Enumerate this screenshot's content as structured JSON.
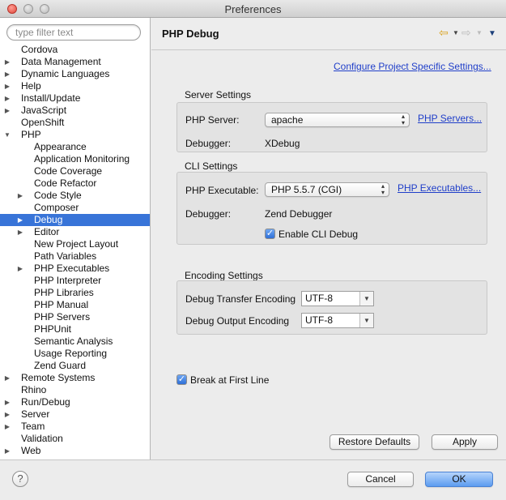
{
  "window": {
    "title": "Preferences"
  },
  "filter": {
    "placeholder": "type filter text"
  },
  "tree": [
    {
      "label": "Cordova",
      "level": 0,
      "arrow": ""
    },
    {
      "label": "Data Management",
      "level": 0,
      "arrow": "right"
    },
    {
      "label": "Dynamic Languages",
      "level": 0,
      "arrow": "right"
    },
    {
      "label": "Help",
      "level": 0,
      "arrow": "right"
    },
    {
      "label": "Install/Update",
      "level": 0,
      "arrow": "right"
    },
    {
      "label": "JavaScript",
      "level": 0,
      "arrow": "right"
    },
    {
      "label": "OpenShift",
      "level": 0,
      "arrow": ""
    },
    {
      "label": "PHP",
      "level": 0,
      "arrow": "down"
    },
    {
      "label": "Appearance",
      "level": 1,
      "arrow": ""
    },
    {
      "label": "Application Monitoring",
      "level": 1,
      "arrow": ""
    },
    {
      "label": "Code Coverage",
      "level": 1,
      "arrow": ""
    },
    {
      "label": "Code Refactor",
      "level": 1,
      "arrow": ""
    },
    {
      "label": "Code Style",
      "level": 1,
      "arrow": "right"
    },
    {
      "label": "Composer",
      "level": 1,
      "arrow": ""
    },
    {
      "label": "Debug",
      "level": 1,
      "arrow": "right",
      "selected": true
    },
    {
      "label": "Editor",
      "level": 1,
      "arrow": "right"
    },
    {
      "label": "New Project Layout",
      "level": 1,
      "arrow": ""
    },
    {
      "label": "Path Variables",
      "level": 1,
      "arrow": ""
    },
    {
      "label": "PHP Executables",
      "level": 1,
      "arrow": "right"
    },
    {
      "label": "PHP Interpreter",
      "level": 1,
      "arrow": ""
    },
    {
      "label": "PHP Libraries",
      "level": 1,
      "arrow": ""
    },
    {
      "label": "PHP Manual",
      "level": 1,
      "arrow": ""
    },
    {
      "label": "PHP Servers",
      "level": 1,
      "arrow": ""
    },
    {
      "label": "PHPUnit",
      "level": 1,
      "arrow": ""
    },
    {
      "label": "Semantic Analysis",
      "level": 1,
      "arrow": ""
    },
    {
      "label": "Usage Reporting",
      "level": 1,
      "arrow": ""
    },
    {
      "label": "Zend Guard",
      "level": 1,
      "arrow": ""
    },
    {
      "label": "Remote Systems",
      "level": 0,
      "arrow": "right"
    },
    {
      "label": "Rhino",
      "level": 0,
      "arrow": ""
    },
    {
      "label": "Run/Debug",
      "level": 0,
      "arrow": "right"
    },
    {
      "label": "Server",
      "level": 0,
      "arrow": "right"
    },
    {
      "label": "Team",
      "level": 0,
      "arrow": "right"
    },
    {
      "label": "Validation",
      "level": 0,
      "arrow": ""
    },
    {
      "label": "Web",
      "level": 0,
      "arrow": "right"
    }
  ],
  "page": {
    "title": "PHP Debug",
    "configure_link": "Configure Project Specific Settings...",
    "server": {
      "group_title": "Server Settings",
      "server_label": "PHP Server:",
      "server_value": "apache",
      "servers_link": "PHP Servers...",
      "debugger_label": "Debugger:",
      "debugger_value": "XDebug"
    },
    "cli": {
      "group_title": "CLI Settings",
      "exec_label": "PHP Executable:",
      "exec_value": "PHP 5.5.7 (CGI)",
      "exec_link": "PHP Executables...",
      "debugger_label": "Debugger:",
      "debugger_value": "Zend Debugger",
      "enable_label": "Enable CLI Debug",
      "enable_checked": true
    },
    "encoding": {
      "group_title": "Encoding Settings",
      "transfer_label": "Debug Transfer Encoding",
      "transfer_value": "UTF-8",
      "output_label": "Debug Output Encoding",
      "output_value": "UTF-8"
    },
    "break_label": "Break at First Line",
    "break_checked": true,
    "restore_label": "Restore Defaults",
    "apply_label": "Apply"
  },
  "footer": {
    "help_glyph": "?",
    "cancel_label": "Cancel",
    "ok_label": "OK"
  },
  "icons": {
    "check": "✓",
    "right": "▶",
    "down": "▼",
    "updown": "▴▾",
    "dd": "▼",
    "back": "⇦",
    "fwd": "⇨"
  }
}
